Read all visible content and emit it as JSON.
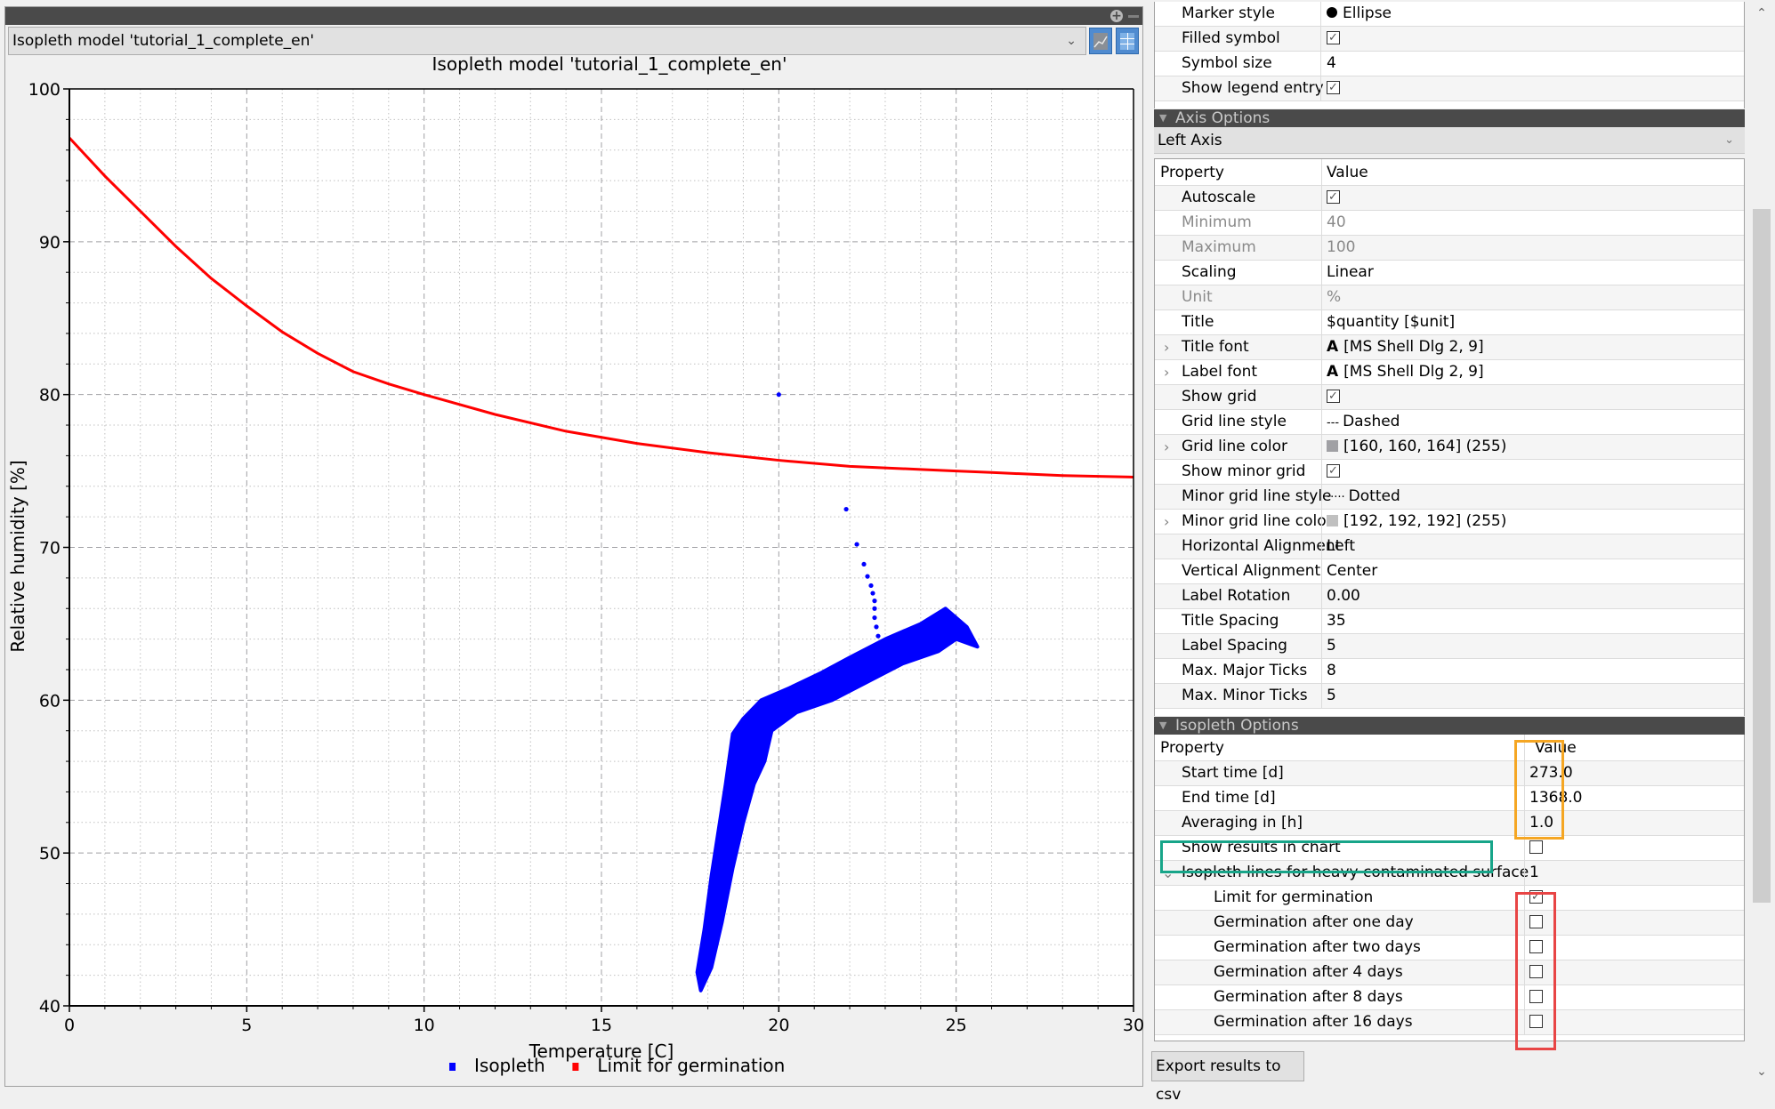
{
  "chart_panel": {
    "model_selector": {
      "selected": "Isopleth model 'tutorial_1_complete_en'"
    },
    "view_buttons": [
      {
        "name": "chart-view",
        "icon": "line-chart-icon"
      },
      {
        "name": "table-view",
        "icon": "table-icon"
      }
    ],
    "dock_buttons": {
      "add": "+",
      "minimize": "−"
    }
  },
  "chart_data": {
    "type": "scatter",
    "title": "Isopleth model 'tutorial_1_complete_en'",
    "xlabel": "Temperature [C]",
    "ylabel": "Relative humidity [%]",
    "xlim": [
      0,
      30
    ],
    "ylim": [
      40,
      100
    ],
    "xticks": [
      0,
      5,
      10,
      15,
      20,
      25,
      30
    ],
    "yticks": [
      40,
      50,
      60,
      70,
      80,
      90,
      100
    ],
    "grid": {
      "major": "dashed",
      "minor": "dotted",
      "major_color": "#a0a0a4",
      "minor_color": "#c0c0c0"
    },
    "legend": {
      "placement": "bottom",
      "entries": [
        {
          "label": "Isopleth",
          "color": "#0000ff"
        },
        {
          "label": "Limit for germination",
          "color": "#ff0000"
        }
      ]
    },
    "series": [
      {
        "name": "Limit for germination",
        "type": "line",
        "color": "#ff0000",
        "x": [
          0,
          1,
          2,
          3,
          4,
          5,
          6,
          7,
          8,
          9,
          10,
          12,
          14,
          15,
          16,
          18,
          20,
          22,
          24,
          25,
          26,
          28,
          30
        ],
        "y": [
          96.8,
          94.3,
          92.0,
          89.7,
          87.6,
          85.8,
          84.1,
          82.7,
          81.5,
          80.7,
          80.0,
          78.7,
          77.6,
          77.2,
          76.8,
          76.2,
          75.7,
          75.3,
          75.1,
          75.0,
          74.9,
          74.7,
          74.6
        ]
      },
      {
        "name": "Isopleth",
        "type": "scatter",
        "color": "#0000ff",
        "marker": "ellipse",
        "outliers": [
          {
            "x": 20.0,
            "y": 80.0
          },
          {
            "x": 21.9,
            "y": 72.5
          },
          {
            "x": 22.2,
            "y": 70.2
          },
          {
            "x": 22.4,
            "y": 68.9
          },
          {
            "x": 22.5,
            "y": 68.1
          },
          {
            "x": 22.6,
            "y": 67.5
          },
          {
            "x": 22.65,
            "y": 67.0
          },
          {
            "x": 22.7,
            "y": 66.5
          },
          {
            "x": 22.7,
            "y": 66.0
          },
          {
            "x": 22.7,
            "y": 65.4
          },
          {
            "x": 22.75,
            "y": 64.8
          },
          {
            "x": 22.8,
            "y": 64.2
          },
          {
            "x": 23.1,
            "y": 63.4
          }
        ],
        "cloud_outline": [
          {
            "x": 17.8,
            "y": 41.0
          },
          {
            "x": 17.7,
            "y": 42.2
          },
          {
            "x": 17.9,
            "y": 45.0
          },
          {
            "x": 18.1,
            "y": 48.5
          },
          {
            "x": 18.3,
            "y": 51.5
          },
          {
            "x": 18.5,
            "y": 54.5
          },
          {
            "x": 18.7,
            "y": 57.8
          },
          {
            "x": 19.0,
            "y": 58.8
          },
          {
            "x": 19.5,
            "y": 60.0
          },
          {
            "x": 20.3,
            "y": 60.8
          },
          {
            "x": 21.2,
            "y": 61.8
          },
          {
            "x": 22.0,
            "y": 62.8
          },
          {
            "x": 23.0,
            "y": 64.0
          },
          {
            "x": 24.0,
            "y": 65.0
          },
          {
            "x": 24.7,
            "y": 66.0
          },
          {
            "x": 25.3,
            "y": 64.8
          },
          {
            "x": 25.6,
            "y": 63.5
          },
          {
            "x": 25.0,
            "y": 64.0
          },
          {
            "x": 24.5,
            "y": 63.2
          },
          {
            "x": 23.5,
            "y": 62.4
          },
          {
            "x": 22.5,
            "y": 61.2
          },
          {
            "x": 21.5,
            "y": 60.0
          },
          {
            "x": 20.5,
            "y": 59.2
          },
          {
            "x": 19.8,
            "y": 58.0
          },
          {
            "x": 19.6,
            "y": 56.0
          },
          {
            "x": 19.3,
            "y": 54.5
          },
          {
            "x": 19.0,
            "y": 52.0
          },
          {
            "x": 18.7,
            "y": 49.0
          },
          {
            "x": 18.4,
            "y": 45.5
          },
          {
            "x": 18.1,
            "y": 42.5
          }
        ]
      }
    ]
  },
  "properties": {
    "series_props": [
      {
        "name": "Marker style",
        "value": "Ellipse",
        "value_icon": "filled-circle-icon"
      },
      {
        "name": "Filled symbol",
        "checkbox": true
      },
      {
        "name": "Symbol size",
        "value": "4"
      },
      {
        "name": "Show legend entry",
        "checkbox": true
      }
    ],
    "axis_options": {
      "header": "Axis Options",
      "axis_selector": "Left Axis",
      "column_headers": {
        "property": "Property",
        "value": "Value"
      },
      "rows": [
        {
          "name": "Autoscale",
          "checkbox": true
        },
        {
          "name": "Minimum",
          "value": "40",
          "disabled": true
        },
        {
          "name": "Maximum",
          "value": "100",
          "disabled": true
        },
        {
          "name": "Scaling",
          "value": "Linear"
        },
        {
          "name": "Unit",
          "value": "%",
          "disabled": true
        },
        {
          "name": "Title",
          "value": "$quantity [$unit]"
        },
        {
          "name": "Title font",
          "value": "[MS Shell Dlg 2, 9]",
          "expandable": true,
          "font_icon": "A"
        },
        {
          "name": "Label font",
          "value": "[MS Shell Dlg 2, 9]",
          "expandable": true,
          "font_icon": "A"
        },
        {
          "name": "Show grid",
          "checkbox": true
        },
        {
          "name": "Grid line style",
          "value": "Dashed",
          "style_glyph": "---"
        },
        {
          "name": "Grid line color",
          "value": "[160, 160, 164] (255)",
          "expandable": true,
          "swatch": "#a0a0a4"
        },
        {
          "name": "Show minor grid",
          "checkbox": true
        },
        {
          "name": "Minor grid line style",
          "value": "Dotted",
          "style_glyph": "·····"
        },
        {
          "name": "Minor grid line color",
          "value": "[192, 192, 192] (255)",
          "expandable": true,
          "swatch": "#c0c0c0"
        },
        {
          "name": "Horizontal Alignment",
          "value": "Left"
        },
        {
          "name": "Vertical Alignment",
          "value": "Center"
        },
        {
          "name": "Label Rotation",
          "value": "0.00"
        },
        {
          "name": "Title Spacing",
          "value": "35"
        },
        {
          "name": "Label Spacing",
          "value": "5"
        },
        {
          "name": "Max. Major Ticks",
          "value": "8"
        },
        {
          "name": "Max. Minor Ticks",
          "value": "5"
        }
      ]
    },
    "isopleth_options": {
      "header": "Isopleth Options",
      "column_headers": {
        "property": "Property",
        "value": "Value"
      },
      "rows": [
        {
          "name": "Start time [d]",
          "value": "273.0"
        },
        {
          "name": "End time [d]",
          "value": "1368.0"
        },
        {
          "name": "Averaging in [h]",
          "value": "1.0"
        },
        {
          "name": "Show results in chart",
          "checkbox": false
        },
        {
          "name": "Isopleth lines for heavy contaminated surface",
          "value": "1",
          "expanded": true
        }
      ],
      "child_rows": [
        {
          "name": "Limit for germination",
          "checkbox": true
        },
        {
          "name": "Germination after one day",
          "checkbox": false
        },
        {
          "name": "Germination after two days",
          "checkbox": false
        },
        {
          "name": "Germination after 4 days",
          "checkbox": false
        },
        {
          "name": "Germination after 8 days",
          "checkbox": false
        },
        {
          "name": "Germination after 16 days",
          "checkbox": false
        }
      ]
    },
    "export_button": "Export results to csv"
  },
  "highlights": {
    "orange": "#f5a623",
    "teal": "#17a589",
    "red": "#e84545"
  }
}
